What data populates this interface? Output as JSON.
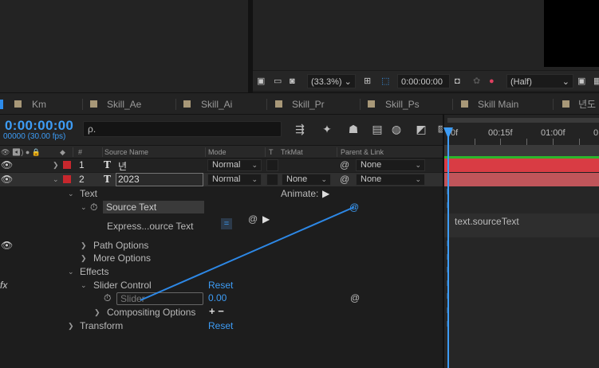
{
  "comp_toolbar": {
    "zoom": "(33.3%)",
    "timecode": "0:00:00:00",
    "resolution": "(Half)"
  },
  "tabs": [
    {
      "label": "Km"
    },
    {
      "label": "Skill_Ae"
    },
    {
      "label": "Skill_Ai"
    },
    {
      "label": "Skill_Pr"
    },
    {
      "label": "Skill_Ps"
    },
    {
      "label": "Skill Main"
    },
    {
      "label": "년도"
    }
  ],
  "timeline": {
    "timecode": "0:00:00:00",
    "fps": "00000 (30.00 fps)",
    "search_placeholder": "ρ.",
    "columns": {
      "num": "#",
      "source_name": "Source Name",
      "mode": "Mode",
      "t": "T",
      "trkmat": "TrkMat",
      "parent": "Parent & Link"
    },
    "ruler": {
      "t0": "0f",
      "t1": "00:15f",
      "t2": "01:00f",
      "t3": "0"
    },
    "layers": [
      {
        "num": "1",
        "type_icon": "T",
        "name": "년",
        "mode": "Normal",
        "trkmat": "",
        "parent": "None",
        "label_color": "#c7272d"
      },
      {
        "num": "2",
        "type_icon": "T",
        "name": "2023",
        "mode": "Normal",
        "trkmat": "None",
        "parent": "None",
        "label_color": "#c7272d"
      }
    ],
    "props": {
      "text": "Text",
      "animate": "Animate:",
      "source_text": "Source Text",
      "expression": "Express...ource Text",
      "expression_value": "text.sourceText",
      "path_options": "Path Options",
      "more_options": "More Options",
      "effects": "Effects",
      "fx": "fx",
      "slider_control": "Slider Control",
      "reset1": "Reset",
      "slider": "Slider",
      "slider_value": "0.00",
      "compositing_options": "Compositing Options",
      "comp_plus_minus": "+ −",
      "transform": "Transform",
      "reset2": "Reset"
    }
  },
  "colors": {
    "accent": "#3d9cf5",
    "layer_bar_1": "#d93c44",
    "layer_bar_2": "#c0555a",
    "label_swatch": "#a89878"
  }
}
